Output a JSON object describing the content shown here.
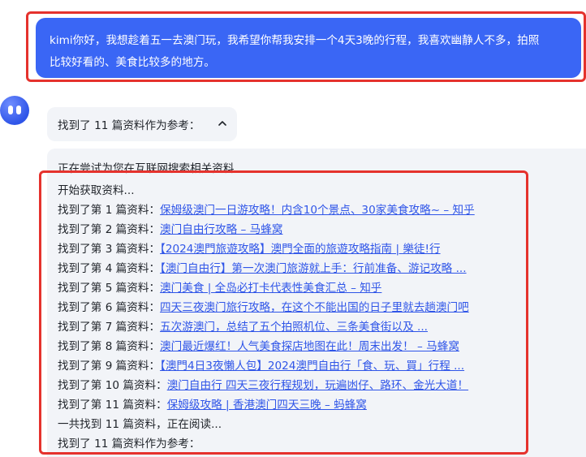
{
  "user_message": {
    "line1": "kimi你好，我想趁着五一去澳门玩，我希望你帮我安排一个4天3晚的行程，我喜欢幽静人不多，拍照",
    "line2": "比较好看的、美食比较多的地方。"
  },
  "reference_toggle": {
    "label": "找到了 11 篇资料作为参考："
  },
  "search_log": {
    "partial_line": "正在尝试为您在互联网搜索相关资料...",
    "start_line": "开始获取资料...",
    "results": [
      {
        "prefix": "找到了第 1 篇资料：",
        "title": "保姆级澳门一日游攻略！内含10个景点、30家美食攻略~ – 知乎"
      },
      {
        "prefix": "找到了第 2 篇资料：",
        "title": "澳门自由行攻略 – 马蜂窝"
      },
      {
        "prefix": "找到了第 3 篇资料：",
        "title": "【2024澳門旅遊攻略】澳門全面的旅遊攻略指南 | 樂徒!行"
      },
      {
        "prefix": "找到了第 4 篇资料：",
        "title": "【澳门自由行】第一次澳门旅游就上手：行前准备、游记攻略 ..."
      },
      {
        "prefix": "找到了第 5 篇资料：",
        "title": "澳门美食 | 全岛必打卡代表性美食汇总 – 知乎"
      },
      {
        "prefix": "找到了第 6 篇资料：",
        "title": "四天三夜澳门旅行攻略，在这个不能出国的日子里就去趟澳门吧"
      },
      {
        "prefix": "找到了第 7 篇资料：",
        "title": "五次游澳门，总结了五个拍照机位、三条美食街以及 ..."
      },
      {
        "prefix": "找到了第 8 篇资料：",
        "title": "澳门最近爆红！人气美食探店地图在此！周末出发！ – 马蜂窝"
      },
      {
        "prefix": "找到了第 9 篇资料：",
        "title": "【澳門4日3夜懶人包】2024澳門自由行「食、玩、買」行程 ..."
      },
      {
        "prefix": "找到了第 10 篇资料：",
        "title": "澳门自由行 四天三夜行程规划，玩遍凼仔、路环、金光大道！"
      },
      {
        "prefix": "找到了第 11 篇资料：",
        "title": "保姆级攻略 | 香港澳门四天三晚 – 蚂蜂窝"
      }
    ],
    "summary_line": "一共找到 11 篇资料，正在阅读...",
    "final_line": "找到了 11 篇资料作为参考："
  }
}
